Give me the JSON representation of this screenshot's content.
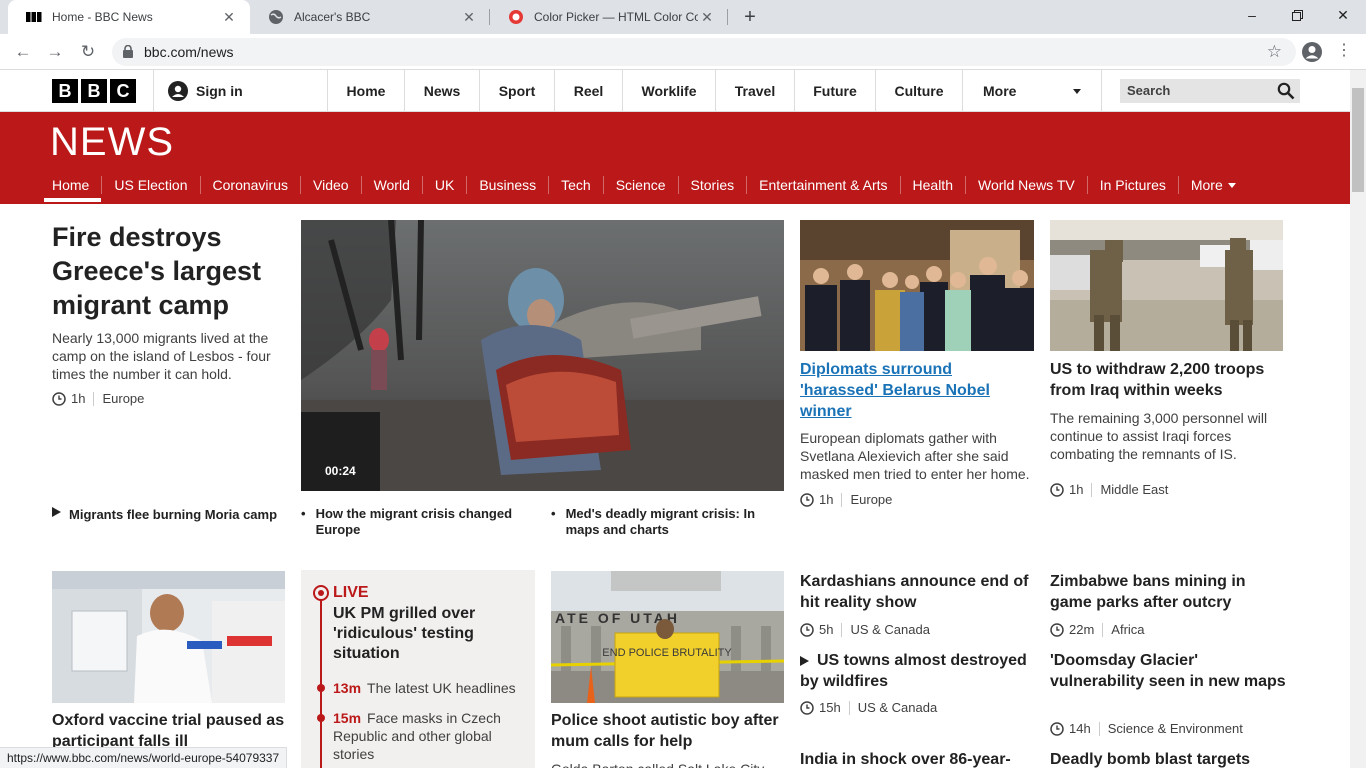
{
  "browser": {
    "tabs": [
      {
        "title": "Home - BBC News",
        "favicon": "bbc-favicon"
      },
      {
        "title": "Alcacer's BBC",
        "favicon": "globe-icon"
      },
      {
        "title": "Color Picker — HTML Color Codes",
        "favicon": "color-picker-favicon"
      }
    ],
    "url": "bbc.com/news",
    "status_url": "https://www.bbc.com/news/world-europe-54079337"
  },
  "bbc_bar": {
    "logo_letters": [
      "B",
      "B",
      "C"
    ],
    "sign_in": "Sign in",
    "nav": [
      "Home",
      "News",
      "Sport",
      "Reel",
      "Worklife",
      "Travel",
      "Future",
      "Culture"
    ],
    "more": "More",
    "search_placeholder": "Search"
  },
  "news_header": {
    "logo": "NEWS",
    "nav": [
      "Home",
      "US Election",
      "Coronavirus",
      "Video",
      "World",
      "UK",
      "Business",
      "Tech",
      "Science",
      "Stories",
      "Entertainment & Arts",
      "Health",
      "World News TV",
      "In Pictures"
    ],
    "more": "More",
    "brand_color": "#bb1919"
  },
  "lead": {
    "title": "Fire destroys Greece's largest migrant camp",
    "summary": "Nearly 13,000 migrants lived at the camp on the island of Lesbos - four times the number it can hold.",
    "time": "1h",
    "section": "Europe",
    "video_duration": "00:24",
    "related": [
      "Migrants flee burning Moria camp",
      "How the migrant crisis changed Europe",
      "Med's deadly migrant crisis: In maps and charts"
    ]
  },
  "story_belarus": {
    "title": "Diplomats surround 'harassed' Belarus Nobel winner",
    "summary": "European diplomats gather with Svetlana Alexievich after she said masked men tried to enter her home.",
    "time": "1h",
    "section": "Europe"
  },
  "story_iraq": {
    "title": "US to withdraw 2,200 troops from Iraq within weeks",
    "summary": "The remaining 3,000 personnel will continue to assist Iraqi forces combating the remnants of IS.",
    "time": "1h",
    "section": "Middle East"
  },
  "story_oxford": {
    "title": "Oxford vaccine trial paused as participant falls ill"
  },
  "live": {
    "label": "LIVE",
    "title": "UK PM grilled over 'ridiculous' testing situation",
    "entries": [
      {
        "time": "13m",
        "text": "The latest UK headlines"
      },
      {
        "time": "15m",
        "text": "Face masks in Czech Republic and other global stories"
      }
    ]
  },
  "story_utah": {
    "title": "Police shoot autistic boy after mum calls for help",
    "summary": "Golda Barton called Salt Lake City",
    "sign_text": "END POLICE BRUTALITY",
    "building_text": "ATE OF UTAH"
  },
  "story_kardashians": {
    "title": "Kardashians announce end of hit reality show",
    "time": "5h",
    "section": "US & Canada"
  },
  "story_wildfires": {
    "title": "US towns almost destroyed by wildfires",
    "time": "15h",
    "section": "US & Canada"
  },
  "story_india": {
    "title": "India in shock over 86-year-"
  },
  "story_zimbabwe": {
    "title": "Zimbabwe bans mining in game parks after outcry",
    "time": "22m",
    "section": "Africa"
  },
  "story_glacier": {
    "title": "'Doomsday Glacier' vulnerability seen in new maps",
    "time": "14h",
    "section": "Science & Environment"
  },
  "story_bomb": {
    "title": "Deadly bomb blast targets"
  }
}
